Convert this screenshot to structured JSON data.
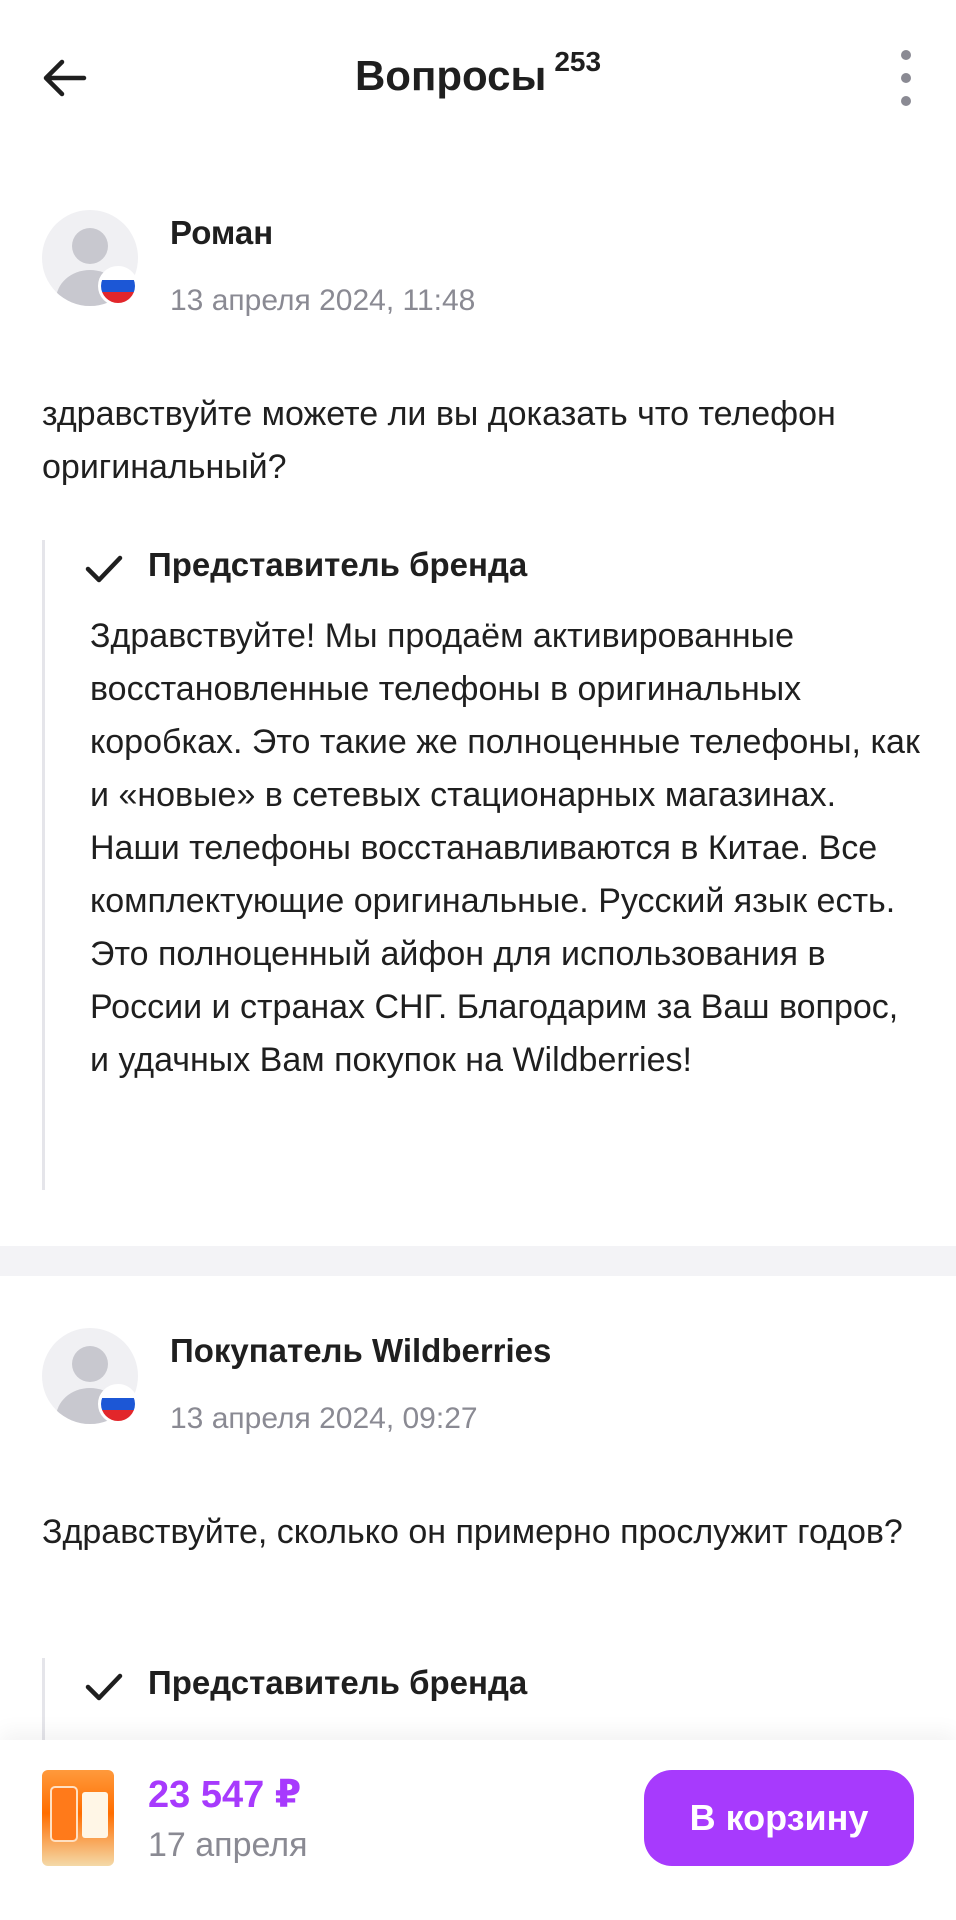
{
  "header": {
    "title": "Вопросы",
    "count": "253"
  },
  "questions": [
    {
      "author": "Роман",
      "date": "13 апреля 2024, 11:48",
      "text": "здравствуйте можете ли вы доказать что телефон оригинальный?",
      "answer_label": "Представитель бренда",
      "answer_text": "Здравствуйте! Мы продаём активированные восстановленные телефоны в оригинальных коробках. Это такие же полноценные телефоны, как и «новые» в сетевых стационарных магазинах. Наши телефоны восстанавливаются в Китае. Все комплектующие оригинальные. Русский язык есть. Это полноценный айфон для использования в России и странах СНГ. Благодарим за Ваш вопрос, и удачных Вам покупок на Wildberries!"
    },
    {
      "author": "Покупатель Wildberries",
      "date": "13 апреля 2024, 09:27",
      "text": "Здравствуйте, сколько он примерно прослужит годов?",
      "answer_label": "Представитель бренда",
      "answer_text": ""
    }
  ],
  "bottom_bar": {
    "price": "23 547 ₽",
    "delivery": "17 апреля",
    "cart_label": "В корзину"
  },
  "colors": {
    "accent": "#a73afd",
    "muted": "#8a8a93",
    "text": "#1f1f1f"
  },
  "icons": {
    "back": "arrow-left-icon",
    "more": "more-vertical-icon",
    "check": "check-icon",
    "flag": "russia-flag-icon",
    "avatar": "user-placeholder-icon"
  }
}
